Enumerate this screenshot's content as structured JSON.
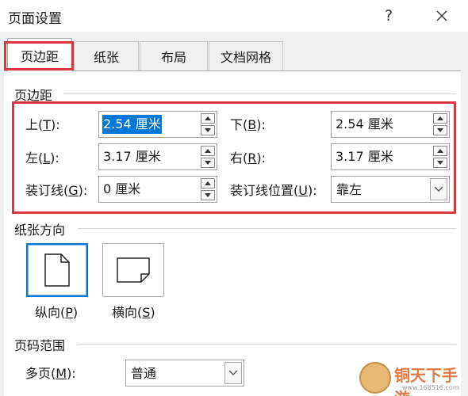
{
  "window": {
    "title": "页面设置",
    "help_glyph": "?"
  },
  "tabs": [
    {
      "label": "页边距"
    },
    {
      "label": "纸张"
    },
    {
      "label": "布局"
    },
    {
      "label": "文档网格"
    }
  ],
  "active_tab": "页边距",
  "margins": {
    "group_title": "页边距",
    "top": {
      "label": "上(",
      "key": "T",
      "suffix": "):",
      "value": "2.54 厘米"
    },
    "bottom": {
      "label": "下(",
      "key": "B",
      "suffix": "):",
      "value": "2.54 厘米"
    },
    "left": {
      "label": "左(",
      "key": "L",
      "suffix": "):",
      "value": "3.17 厘米"
    },
    "right": {
      "label": "右(",
      "key": "R",
      "suffix": "):",
      "value": "3.17 厘米"
    },
    "gutter": {
      "label": "装订线(",
      "key": "G",
      "suffix": "):",
      "value": "0 厘米"
    },
    "gutter_position": {
      "label": "装订线位置(",
      "key": "U",
      "suffix": "):",
      "value": "靠左"
    }
  },
  "orientation": {
    "group_title": "纸张方向",
    "portrait": {
      "label": "纵向(",
      "key": "P",
      "suffix": ")"
    },
    "landscape": {
      "label": "横向(",
      "key": "S",
      "suffix": ")"
    },
    "selected": "portrait"
  },
  "pages": {
    "group_title": "页码范围",
    "multiple": {
      "label": "多页(",
      "key": "M",
      "suffix": "):",
      "value": "普通"
    }
  },
  "watermark": {
    "text": "铜天下手游",
    "sub": "www.168516.com"
  },
  "colors": {
    "highlight_red": "#d9363e",
    "selection_blue": "#0078d7",
    "watermark_orange": "#e07a45"
  }
}
